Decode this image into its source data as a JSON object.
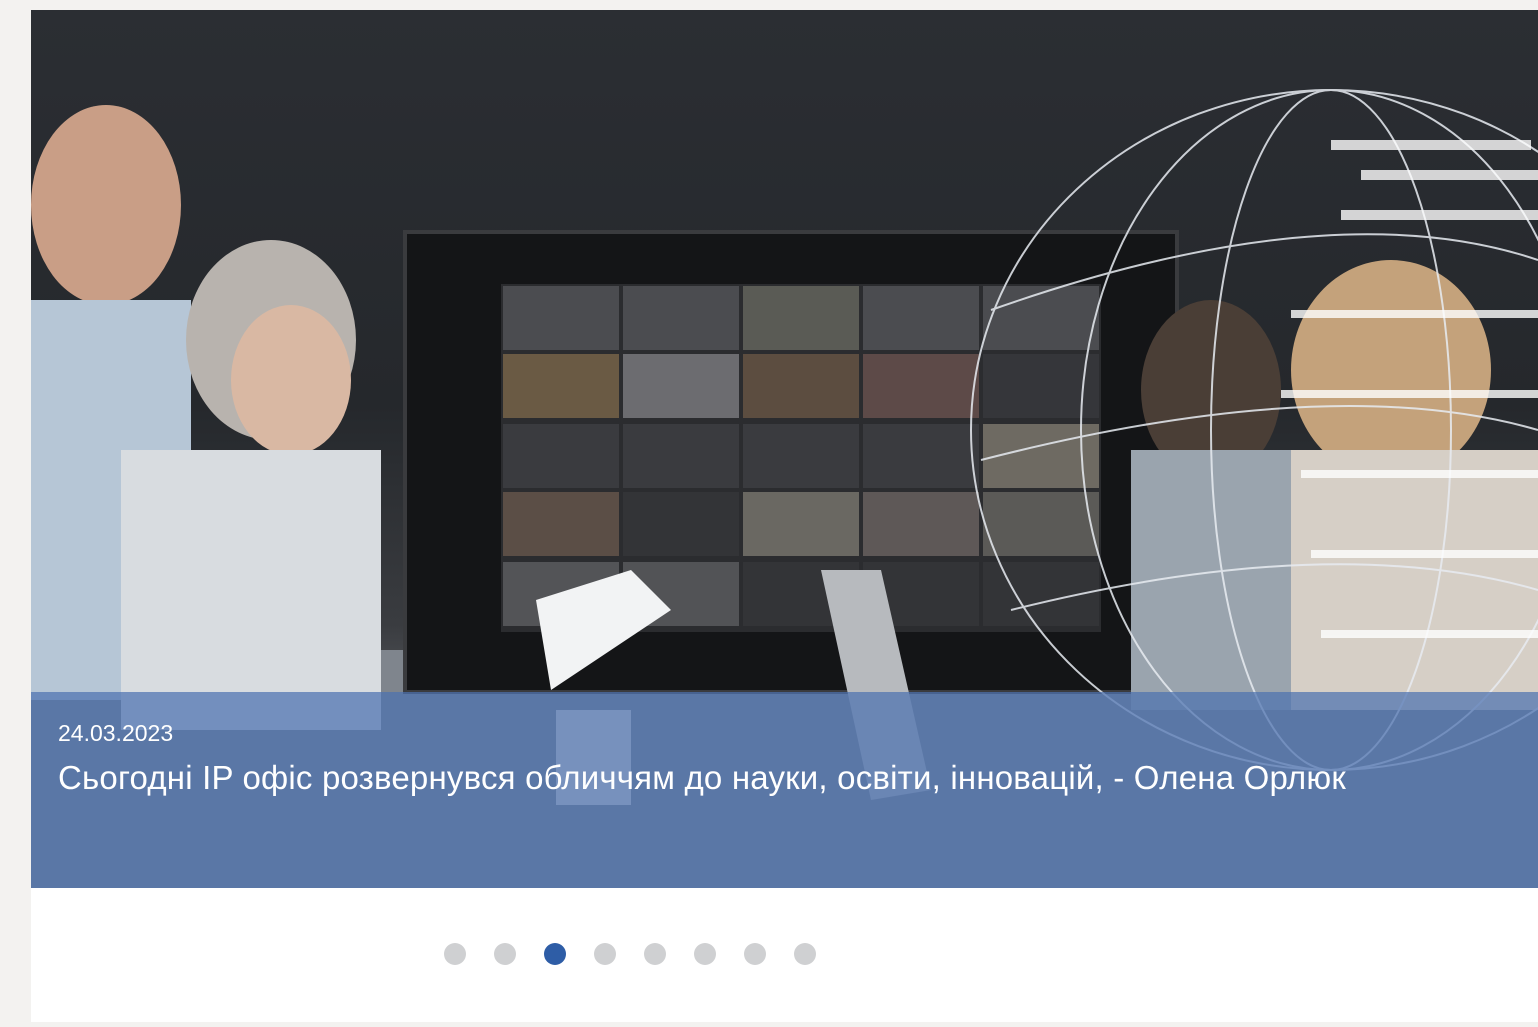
{
  "slide": {
    "date": "24.03.2023",
    "title": "Сьогодні IP офіс розвернувся обличчям до науки, освіти, інновацій, - Олена Орлюк",
    "image_alt": "Nараду з учасниками відеоконференції на великому екрані"
  },
  "pagination": {
    "total": 8,
    "active_index": 2
  },
  "colors": {
    "caption_overlay": "#4c72b0",
    "dot_active": "#2e5da6",
    "dot_inactive": "#cfd0d2"
  }
}
